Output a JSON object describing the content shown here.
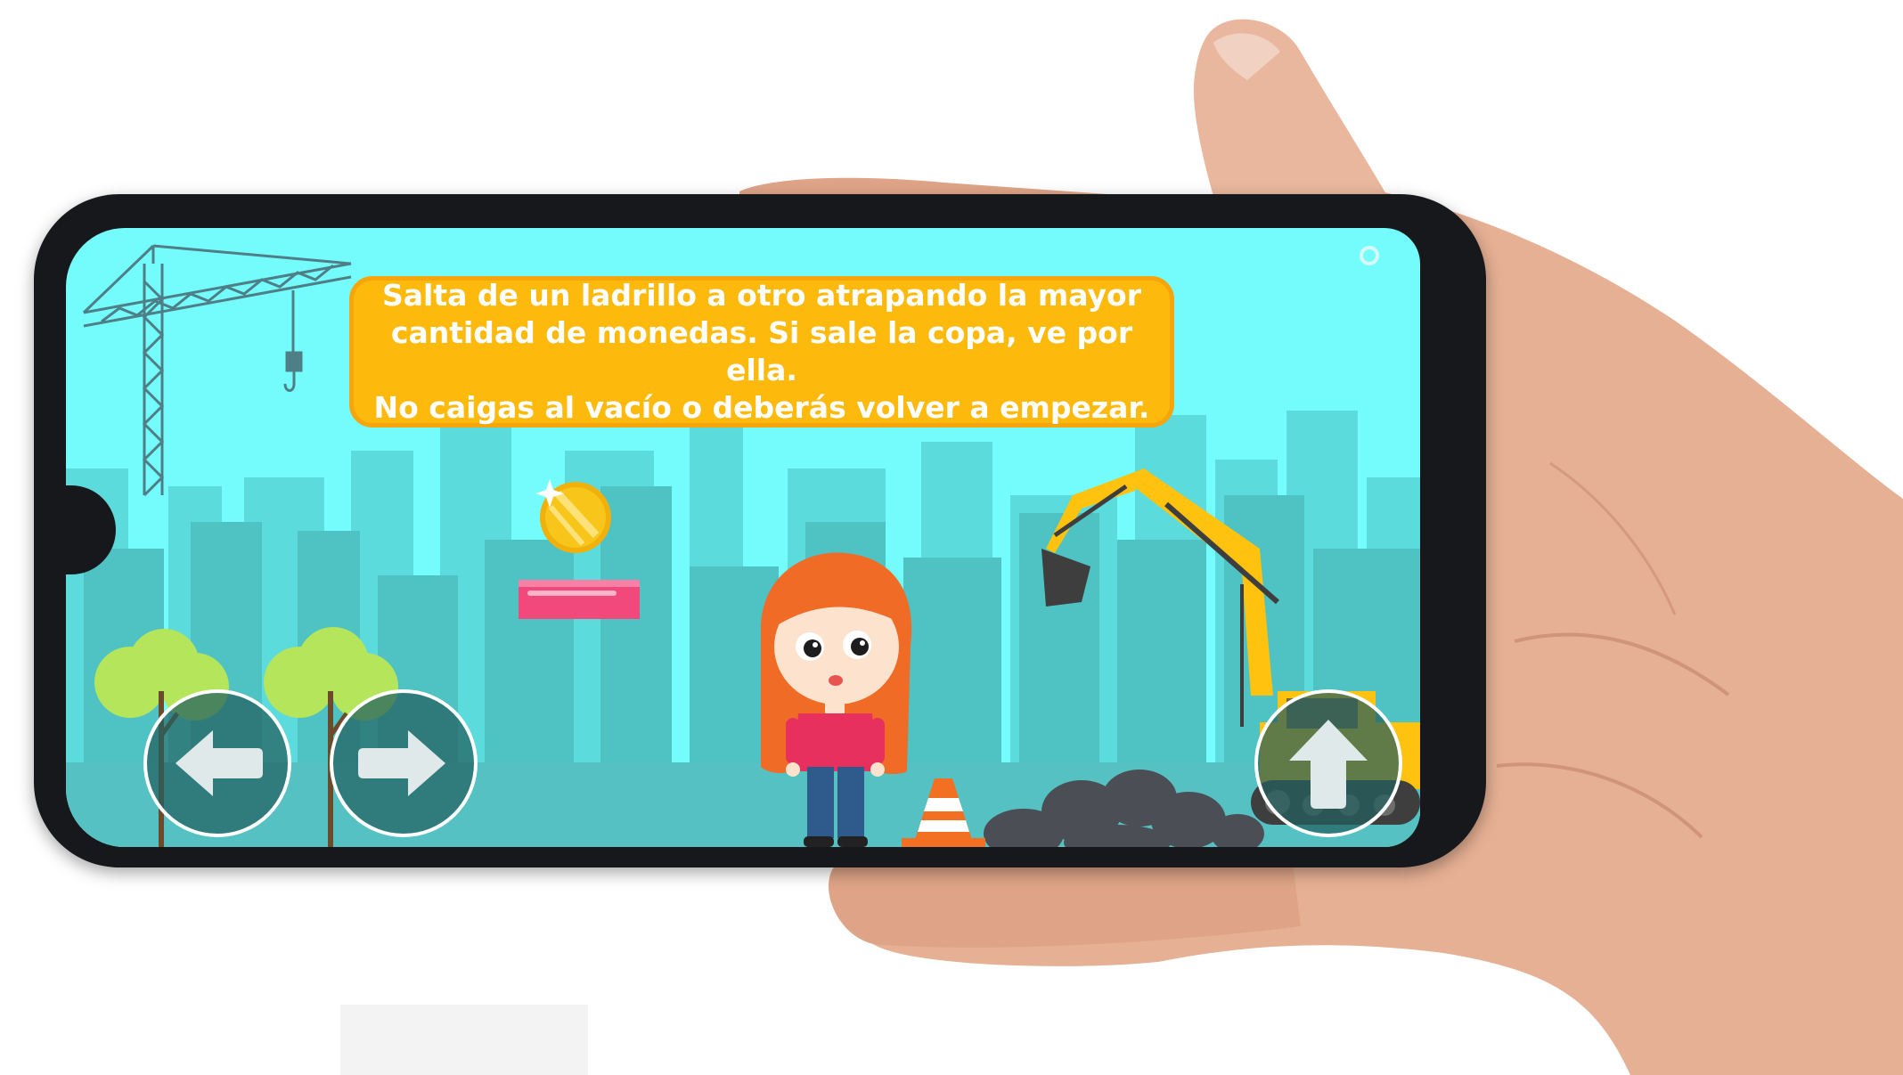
{
  "game": {
    "instructions": [
      "Salta de un ladrillo a otro atrapando la mayor",
      "cantidad de monedas. Si sale la copa, ve por ella.",
      "No caigas al vacío o deberás volver a empezar."
    ]
  },
  "controls": {
    "left_icon": "arrow-left-icon",
    "right_icon": "arrow-right-icon",
    "jump_icon": "arrow-up-icon"
  },
  "colors": {
    "sky": "#74fcfd",
    "instruction_box": "#fdb90c",
    "control_button": "#2f7373",
    "brick": "#f1497b",
    "coin": "#f8c51b"
  }
}
